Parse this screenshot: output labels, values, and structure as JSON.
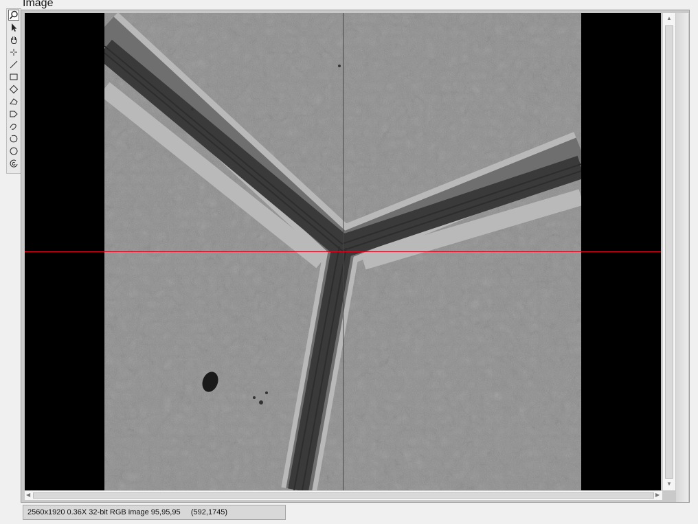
{
  "window": {
    "title": "Image"
  },
  "toolbar": {
    "tools": [
      {
        "name": "zoom",
        "icon": "magnifier-icon",
        "active": true
      },
      {
        "name": "select",
        "icon": "arrow-pointer-icon",
        "active": false
      },
      {
        "name": "pan",
        "icon": "hand-icon",
        "active": false
      },
      {
        "name": "point",
        "icon": "crosshair-point-icon",
        "active": false
      },
      {
        "name": "line",
        "icon": "line-icon",
        "active": false
      },
      {
        "name": "rectangle",
        "icon": "rectangle-icon",
        "active": false
      },
      {
        "name": "rotated-rectangle",
        "icon": "rotated-rectangle-icon",
        "active": false
      },
      {
        "name": "polygon",
        "icon": "polygon-icon",
        "active": false
      },
      {
        "name": "freehand-polygon",
        "icon": "freehand-polygon-icon",
        "active": false
      },
      {
        "name": "freehand-line",
        "icon": "freehand-line-icon",
        "active": false
      },
      {
        "name": "annulus",
        "icon": "annulus-icon",
        "active": false
      },
      {
        "name": "oval",
        "icon": "oval-icon",
        "active": false
      },
      {
        "name": "broken-annulus",
        "icon": "broken-annulus-icon",
        "active": false
      }
    ]
  },
  "image": {
    "crosshair_color": "#e0001b"
  },
  "status": {
    "text": "2560x1920 0.36X 32-bit RGB image 95,95,95     (592,1745)"
  }
}
